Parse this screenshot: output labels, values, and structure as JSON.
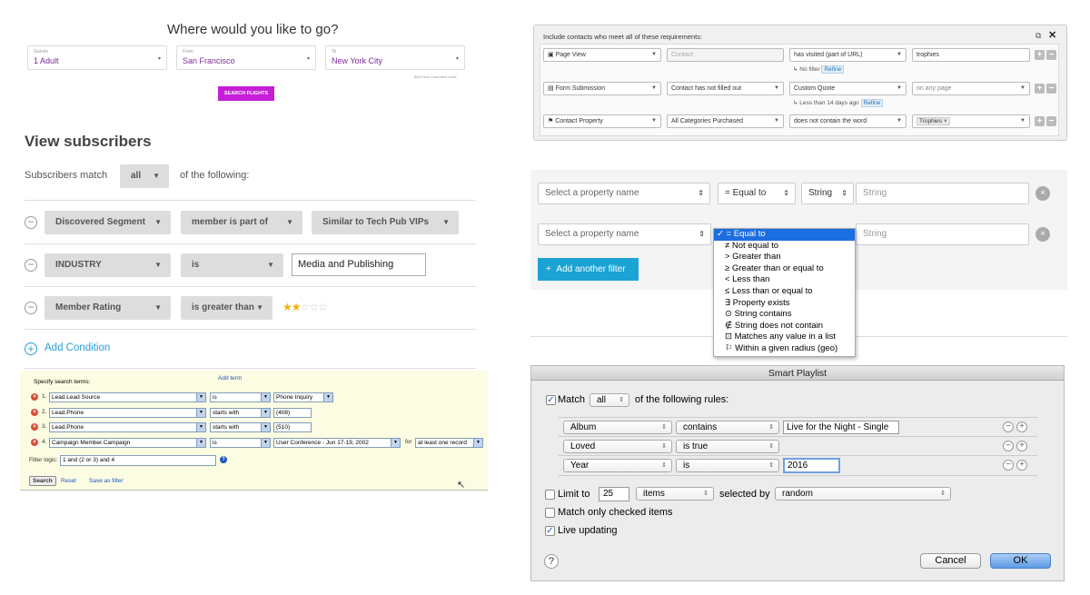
{
  "flight": {
    "title": "Where would you like to go?",
    "guests_label": "Guests",
    "guests_value": "1 Adult",
    "from_label": "From",
    "from_value": "San Francisco",
    "to_label": "To",
    "to_value": "New York City",
    "note": "Best Fares Guaranteed online",
    "search_button": "SEARCH FLIGHTS",
    "button_color": "#c41fd6"
  },
  "subscribers": {
    "title": "View subscribers",
    "match_prefix": "Subscribers match",
    "match_value": "all",
    "match_suffix": "of the following:",
    "rows": [
      {
        "field": "Discovered Segment",
        "operator": "member is part of",
        "value": "Similar to Tech Pub VIPs"
      },
      {
        "field": "INDUSTRY",
        "operator": "is",
        "value": "Media and Publishing"
      },
      {
        "field": "Member Rating",
        "operator": "is greater than",
        "rating": 2,
        "rating_max": 5
      }
    ],
    "add_condition": "Add Condition",
    "accent": "#2a9fd6"
  },
  "salesforce": {
    "add_term": "Add term",
    "heading": "Specify search terms:",
    "rows": [
      {
        "num": "1.",
        "field": "Lead.Lead Source",
        "operator": "is",
        "value": "Phone Inquiry"
      },
      {
        "num": "2.",
        "field": "Lead.Phone",
        "operator": "starts with",
        "value": "(408)"
      },
      {
        "num": "3.",
        "field": "Lead.Phone",
        "operator": "starts with",
        "value": "(510)"
      },
      {
        "num": "4.",
        "field": "Campaign Member.Campaign",
        "operator": "is",
        "value": "User Conference - Jun 17-19, 2002",
        "for_label": "for",
        "for_value": "at least one record"
      }
    ],
    "filter_logic_label": "Filter logic:",
    "filter_logic_value": "1 and (2 or 3) and 4",
    "search_button": "Search",
    "reset_link": "Reset",
    "save_link": "Save as filter"
  },
  "contacts": {
    "heading": "Include contacts who meet all of these requirements:",
    "rows": [
      {
        "type": "Page View",
        "prop": "Contact",
        "operator": "has visited (part of URL)",
        "value": "trophies",
        "sub_text": "No filter",
        "refine": "Refine"
      },
      {
        "type": "Form Submission",
        "prop": "Contact has not filled out",
        "operator": "Custom Quote",
        "value": "on any page",
        "sub_text": "Less than 14 days ago",
        "refine": "Refine"
      },
      {
        "type": "Contact Property",
        "prop": "All Categories Purchased",
        "operator": "does not contain the word",
        "tag": "Trophies"
      }
    ]
  },
  "property_filter": {
    "row1": {
      "property": "Select a property name",
      "operator": "= Equal to",
      "type": "String",
      "value_placeholder": "String"
    },
    "row2": {
      "property": "Select a property name",
      "value_placeholder": "String"
    },
    "add_button": "Add another filter",
    "button_color": "#1aa3d4",
    "dropdown": [
      "✓ = Equal to",
      "≠ Not equal to",
      "> Greater than",
      "≥ Greater than or equal to",
      "< Less than",
      "≤ Less than or equal to",
      "∃ Property exists",
      "⊙ String contains",
      "∉ String does not contain",
      "⊡ Matches any value in a list",
      "⚐ Within a given radius (geo)"
    ]
  },
  "playlist": {
    "title": "Smart Playlist",
    "match_label": "Match",
    "match_value": "all",
    "match_suffix": "of the following rules:",
    "rules": [
      {
        "field": "Album",
        "operator": "contains",
        "value": "Live for the Night - Single"
      },
      {
        "field": "Loved",
        "operator": "is true",
        "value": ""
      },
      {
        "field": "Year",
        "operator": "is",
        "value": "2016"
      }
    ],
    "limit_label": "Limit to",
    "limit_value": "25",
    "limit_unit": "items",
    "selected_by_label": "selected by",
    "selected_by_value": "random",
    "match_checked_label": "Match only checked items",
    "live_updating_label": "Live updating",
    "cancel_button": "Cancel",
    "ok_button": "OK",
    "help_icon": "?"
  }
}
